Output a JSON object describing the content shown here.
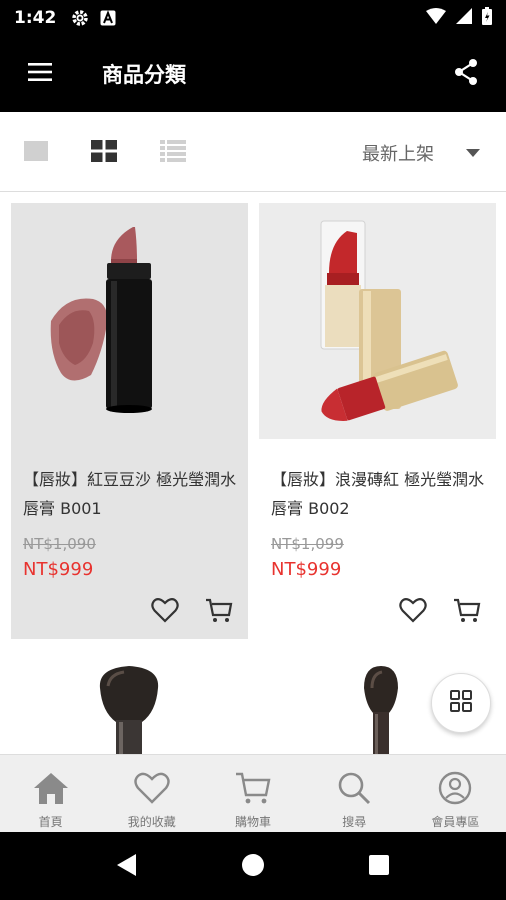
{
  "status_bar": {
    "time": "1:42"
  },
  "app_bar": {
    "title": "商品分類"
  },
  "toolbar": {
    "sort_label": "最新上架"
  },
  "products": [
    {
      "name": "【唇妝】紅豆豆沙 極光瑩潤水唇膏 B001",
      "old_price": "NT$1,090",
      "price": "NT$999"
    },
    {
      "name": "【唇妝】浪漫磚紅 極光瑩潤水唇膏 B002",
      "old_price": "NT$1,099",
      "price": "NT$999"
    }
  ],
  "bottom_nav": {
    "items": [
      {
        "label": "首頁",
        "icon": "home-icon"
      },
      {
        "label": "我的收藏",
        "icon": "heart-icon"
      },
      {
        "label": "購物車",
        "icon": "cart-icon"
      },
      {
        "label": "搜尋",
        "icon": "search-icon"
      },
      {
        "label": "會員專區",
        "icon": "user-icon"
      }
    ]
  },
  "colors": {
    "price": "#e8332f",
    "app_bar": "#000000",
    "nav_bg": "#efefef"
  }
}
